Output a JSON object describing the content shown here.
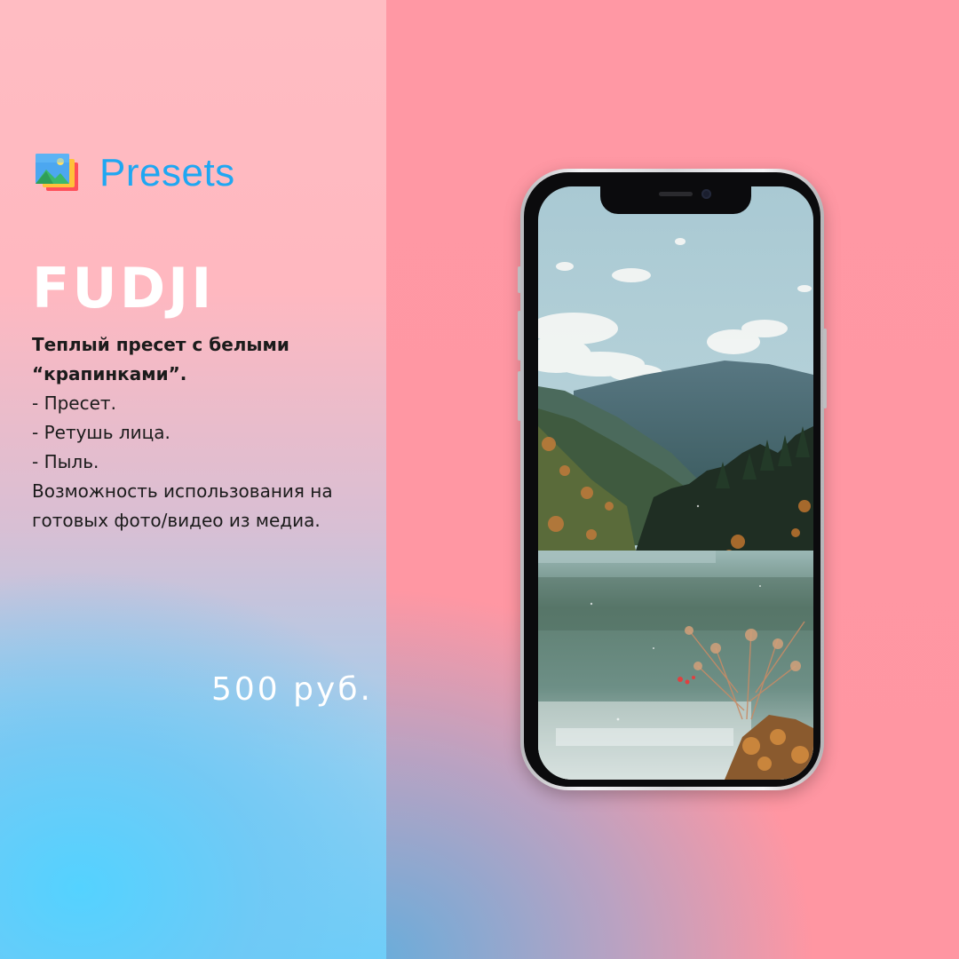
{
  "brand": {
    "title": "Presets",
    "icon": "image-stack-icon",
    "color": "#1fa7f2"
  },
  "product": {
    "name": "FUDJI",
    "description_lead": "Теплый пресет с белыми “крапинками”.",
    "items": [
      "- Пресет.",
      "- Ретушь лица.",
      "- Пыль."
    ],
    "note": "Возможность использования на готовых фото/видео из медиа.",
    "price": "500 руб."
  },
  "phone_preview": {
    "image": "mountain-lake-landscape"
  },
  "colors": {
    "pink": "#ff98a4",
    "blue": "#6fd0fa"
  }
}
